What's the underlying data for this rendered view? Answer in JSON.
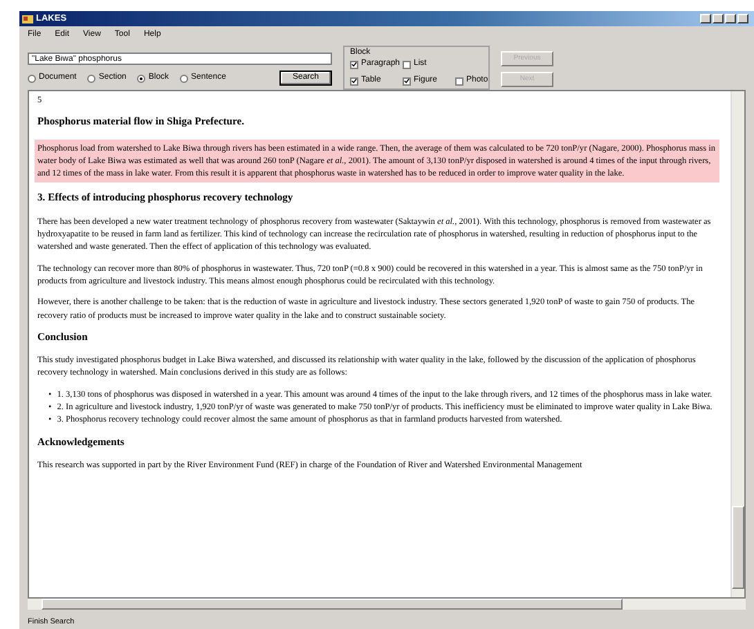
{
  "window": {
    "title": "LAKES"
  },
  "menu": [
    "File",
    "Edit",
    "View",
    "Tool",
    "Help"
  ],
  "search": {
    "value": "\"Lake Biwa\" phosphorus",
    "button": "Search"
  },
  "scopes": [
    {
      "label": "Document",
      "selected": false
    },
    {
      "label": "Section",
      "selected": false
    },
    {
      "label": "Block",
      "selected": true
    },
    {
      "label": "Sentence",
      "selected": false
    }
  ],
  "block_filter": {
    "title": "Block",
    "options": [
      {
        "label": "Paragraph",
        "checked": true
      },
      {
        "label": "List",
        "checked": false
      },
      {
        "label": "Table",
        "checked": true
      },
      {
        "label": "Figure",
        "checked": true
      },
      {
        "label": "Photo",
        "checked": false
      }
    ]
  },
  "nav_buttons": [
    {
      "label": "Previous",
      "disabled": true
    },
    {
      "label": "Next",
      "disabled": true
    }
  ],
  "content": [
    {
      "kind": "text",
      "text": "5",
      "highlighted": false
    },
    {
      "kind": "heading",
      "text": "Phosphorus material flow in Shiga Prefecture."
    },
    {
      "kind": "text",
      "highlighted": true,
      "text": "Phosphorus load from watershed to Lake Biwa through rivers has been estimated in a wide range. Then, the average of them was calculated to be 720 tonP/yr (Nagare, 2000). Phosphorus mass in water body of Lake Biwa was estimated as well that was around 260 tonP (Nagare *et al.*, 2001). The amount of 3,130 tonP/yr disposed in watershed is around 4 times of the input through rivers, and 12 times of the mass in lake water. From this result it is apparent that phosphorus waste in watershed has to be reduced in order to improve water quality in the lake."
    },
    {
      "kind": "heading",
      "text": "3. Effects of introducing phosphorus recovery technology"
    },
    {
      "kind": "text",
      "highlighted": false,
      "text": "There has been developed a new water treatment technology of phosphorus recovery from wastewater (Saktaywin *et al.*, 2001). With this technology, phosphorus is removed from wastewater as hydroxyapatite to be reused in farm land as fertilizer. This kind of technology can increase the recirculation rate of phosphorus in watershed, resulting in reduction of phosphorus input to the watershed and waste generated. Then the effect of application of this technology was evaluated."
    },
    {
      "kind": "text",
      "highlighted": false,
      "text": "The technology can recover more than 80% of phosphorus in wastewater. Thus, 720 tonP (=0.8 x 900) could be recovered in this watershed in a year. This is almost same as the 750 tonP/yr in products from agriculture and livestock industry. This means almost enough phosphorus could be recirculated with this technology."
    },
    {
      "kind": "text",
      "highlighted": false,
      "text": "However, there is another challenge to be taken: that is the reduction of waste in agriculture and livestock industry. These sectors generated 1,920 tonP of waste to gain 750 of products. The recovery ratio of products must be increased to improve water quality in the lake and to construct sustainable society."
    },
    {
      "kind": "heading",
      "text": "Conclusion"
    },
    {
      "kind": "text",
      "highlighted": false,
      "text": "This study investigated phosphorus budget in Lake Biwa watershed, and discussed its relationship with water quality in the lake, followed by the discussion of the application of phosphorus recovery technology in watershed. Main conclusions derived in this study are as follows:"
    },
    {
      "kind": "list",
      "marker": "•",
      "items": [
        "1. 3,130 tons of phosphorus was disposed in watershed in a year. This amount was around 4 times of the input to the lake through rivers, and 12 times of the phosphorus mass in lake water.",
        "2. In agriculture and livestock industry, 1,920 tonP/yr of waste was generated to make 750 tonP/yr of products. This inefficiency must be eliminated to improve water quality in Lake Biwa.",
        "3. Phosphorus recovery technology could recover almost the same amount of phosphorus as that in farmland products harvested from watershed."
      ]
    },
    {
      "kind": "heading",
      "text": "Acknowledgements"
    },
    {
      "kind": "text",
      "highlighted": false,
      "text": "This research was supported in part by the River Environment Fund (REF) in charge of the Foundation of River and Watershed Environmental Management"
    }
  ],
  "status_bar": "Finish Search"
}
